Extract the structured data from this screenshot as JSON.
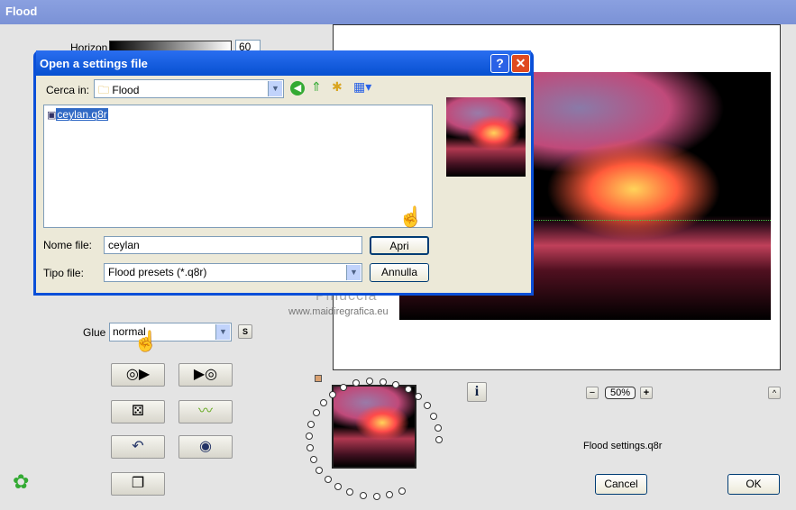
{
  "window": {
    "title": "Flood"
  },
  "controls": {
    "horizon_label": "Horizon",
    "horizon_value": "60",
    "horizon_fraction": 0.6,
    "glue_label": "Glue",
    "glue_value": "normal",
    "s_button": "S"
  },
  "dialog": {
    "title": "Open a settings file",
    "help": "?",
    "close": "✕",
    "look_in_label": "Cerca in:",
    "look_in_value": "Flood",
    "files": [
      {
        "name": "ceylan.q8r",
        "selected": true
      }
    ],
    "filename_label": "Nome file:",
    "filename_value": "ceylan",
    "filetype_label": "Tipo file:",
    "filetype_value": "Flood presets (*.q8r)",
    "open_button": "Apri",
    "cancel_button": "Annulla"
  },
  "watermark": {
    "name": "Pinuccia",
    "url": "www.maidiregrafica.eu"
  },
  "zoom": {
    "minus": "−",
    "value": "50%",
    "plus": "+"
  },
  "info_button": "i",
  "collapse_button": "^",
  "settings_file": "Flood settings.q8r",
  "footer": {
    "cancel": "Cancel",
    "ok": "OK"
  }
}
